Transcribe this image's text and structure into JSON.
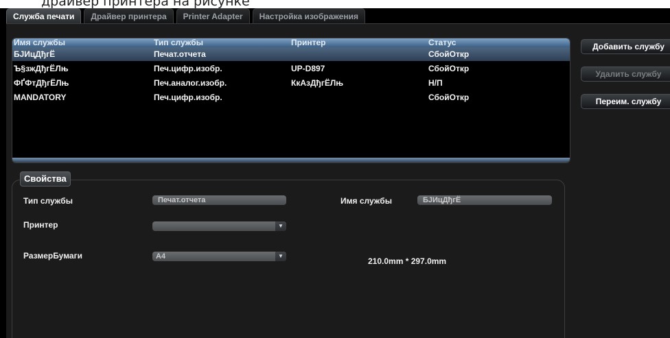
{
  "caption_fragment": "драйвер принтера на рисунке",
  "tabs": [
    {
      "label": "Служба печати",
      "active": true
    },
    {
      "label": "Драйвер принтера",
      "active": false
    },
    {
      "label": "Printer Adapter",
      "active": false
    },
    {
      "label": "Настройка изображения",
      "active": false
    }
  ],
  "table": {
    "headers": [
      "Имя службы",
      "Тип службы",
      "Принтер",
      "Статус"
    ],
    "rows": [
      [
        "БЈИцДђгЁ",
        "Печат.отчета",
        "",
        "СбойОткр"
      ],
      [
        "Ъ§зжДђгЁЛњ",
        "Печ.цифр.изобр.",
        "UP-D897",
        "СбойОткр"
      ],
      [
        "ФҐФтДђгЁЛњ",
        "Печ.аналог.изобр.",
        "КкАзДђгЁЛњ",
        "Н/П"
      ],
      [
        "MANDATORY",
        "Печ.цифр.изобр.",
        "",
        "СбойОткр"
      ]
    ],
    "selected_row": 0
  },
  "side_buttons": {
    "add": "Добавить службу",
    "delete": "Удалить службу",
    "rename": "Переим. службу"
  },
  "properties": {
    "legend": "Свойства",
    "service_type_label": "Тип службы",
    "service_type_value": "Печат.отчета",
    "service_name_label": "Имя службы",
    "service_name_value": "БЈИцДђгЁ",
    "printer_label": "Принтер",
    "printer_value": "",
    "paper_label": "РазмерБумаги",
    "paper_value": "A4",
    "paper_dimensions": "210.0mm * 297.0mm"
  },
  "colors": {
    "background": "#000000",
    "panel": "#1b1b1b",
    "header_blue": "#5a7fa6",
    "selection": "#3e5570"
  }
}
